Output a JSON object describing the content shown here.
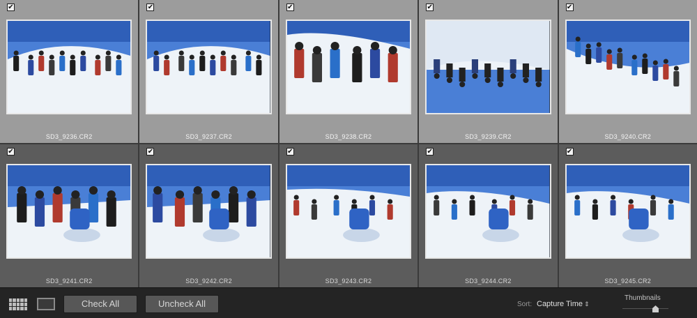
{
  "grid": {
    "items": [
      {
        "filename": "SD3_9236.CR2",
        "checked": true,
        "selected": true,
        "scene": "group-hill"
      },
      {
        "filename": "SD3_9237.CR2",
        "checked": true,
        "selected": true,
        "scene": "group-hill"
      },
      {
        "filename": "SD3_9238.CR2",
        "checked": true,
        "selected": true,
        "scene": "people-close"
      },
      {
        "filename": "SD3_9239.CR2",
        "checked": true,
        "selected": true,
        "scene": "upside-down"
      },
      {
        "filename": "SD3_9240.CR2",
        "checked": true,
        "selected": true,
        "scene": "slope-line"
      },
      {
        "filename": "SD3_9241.CR2",
        "checked": true,
        "selected": false,
        "scene": "digging-close"
      },
      {
        "filename": "SD3_9242.CR2",
        "checked": true,
        "selected": false,
        "scene": "digging-close"
      },
      {
        "filename": "SD3_9243.CR2",
        "checked": true,
        "selected": false,
        "scene": "digging-pit"
      },
      {
        "filename": "SD3_9244.CR2",
        "checked": true,
        "selected": false,
        "scene": "digging-wide"
      },
      {
        "filename": "SD3_9245.CR2",
        "checked": true,
        "selected": false,
        "scene": "digging-wide"
      }
    ]
  },
  "toolbar": {
    "check_all_label": "Check All",
    "uncheck_all_label": "Uncheck All",
    "sort_label": "Sort:",
    "sort_value": "Capture Time",
    "sort_arrow": "⇕",
    "thumbnails_label": "Thumbnails",
    "thumbnail_size": 0.72
  },
  "icons": {
    "check": "✔",
    "grid_view": "grid-view-icon",
    "loupe_view": "loupe-view-icon"
  },
  "colors": {
    "selected_cell": "#9c9c9c",
    "unselected_cell": "#5c5c5c",
    "sky": "#4a7fd6",
    "snow": "#eef3f8"
  }
}
